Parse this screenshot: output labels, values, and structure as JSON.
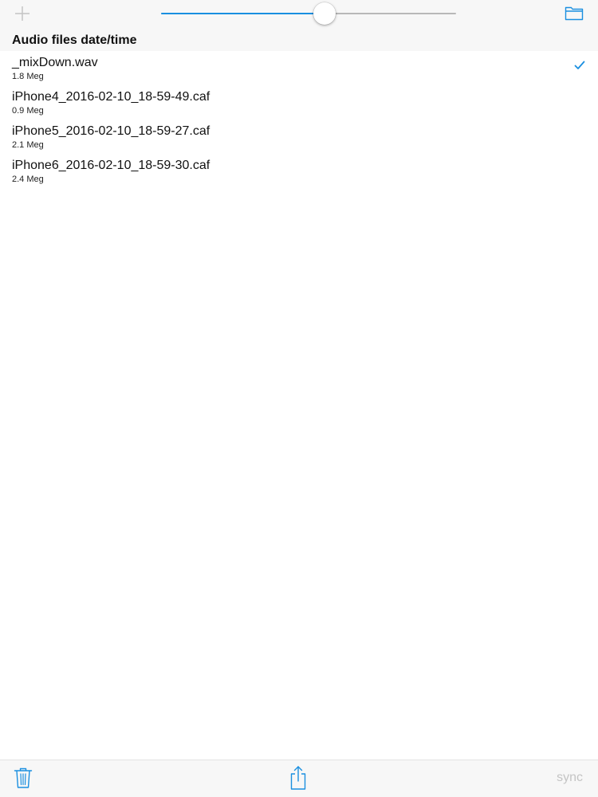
{
  "toolbar": {
    "add_icon": "plus-icon",
    "folder_icon": "folder-icon",
    "slider": {
      "value_percent": 55.4
    }
  },
  "section": {
    "title": "Audio files date/time"
  },
  "files": [
    {
      "name": "_mixDown.wav",
      "size": "1.8 Meg",
      "selected": true
    },
    {
      "name": "iPhone4_2016-02-10_18-59-49.caf",
      "size": "0.9 Meg",
      "selected": false
    },
    {
      "name": "iPhone5_2016-02-10_18-59-27.caf",
      "size": "2.1 Meg",
      "selected": false
    },
    {
      "name": "iPhone6_2016-02-10_18-59-30.caf",
      "size": "2.4 Meg",
      "selected": false
    }
  ],
  "bottom_bar": {
    "trash_icon": "trash-icon",
    "share_icon": "share-icon",
    "sync_label": "sync"
  },
  "colors": {
    "accent": "#1a8fe0",
    "disabled": "#c4c4c4",
    "bar_background": "#f7f7f7"
  }
}
